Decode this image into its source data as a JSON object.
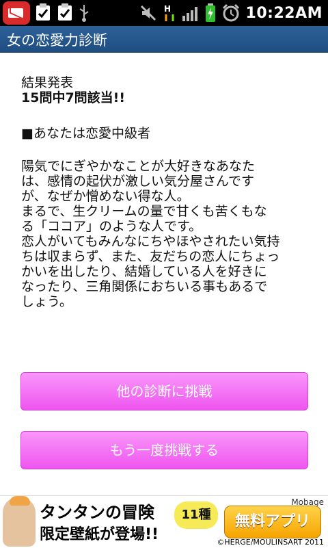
{
  "status_bar": {
    "time": "10:22AM",
    "icons": [
      "gmail-icon",
      "task-check-icon",
      "task-check-icon",
      "usb-icon",
      "mute-icon",
      "h-signal-icon",
      "signal-bars-icon",
      "battery-charging-icon",
      "alarm-icon"
    ]
  },
  "app": {
    "title": "女の恋愛力診断"
  },
  "result": {
    "heading": "結果発表",
    "count": "15問中7問該当!!",
    "type": "■あなたは恋愛中級者",
    "description_lines": [
      "陽気でにぎやかなことが大好きなあなた",
      "は、感情の起伏が激しい気分屋さんです",
      "が、なぜか憎めない得な人。",
      "まるで、生クリームの量で甘くも苦くもな",
      "る「ココア」のような人です。",
      "恋人がいてもみんなにちやほやされたい気持",
      "ちは収まらず、また、友だちの恋人にちょっ",
      "かいを出したり、結婚している人を好きに",
      "なったり、三角関係におちいる事もあるで",
      "しょう。"
    ]
  },
  "buttons": {
    "other_diagnosis": "他の診断に挑戦",
    "retry": "もう一度挑戦する"
  },
  "ad": {
    "title": "タンタンの冒険",
    "subtitle": "限定壁紙が登場!!",
    "badge": "11種",
    "brand": "Mobage",
    "cta": "無料アプリ",
    "copyright": "©HERGE/MOULINSART 2011"
  },
  "colors": {
    "status_bg": "#000000",
    "titlebar": "#2a5a8f",
    "button_pink": "#f36ef3"
  }
}
